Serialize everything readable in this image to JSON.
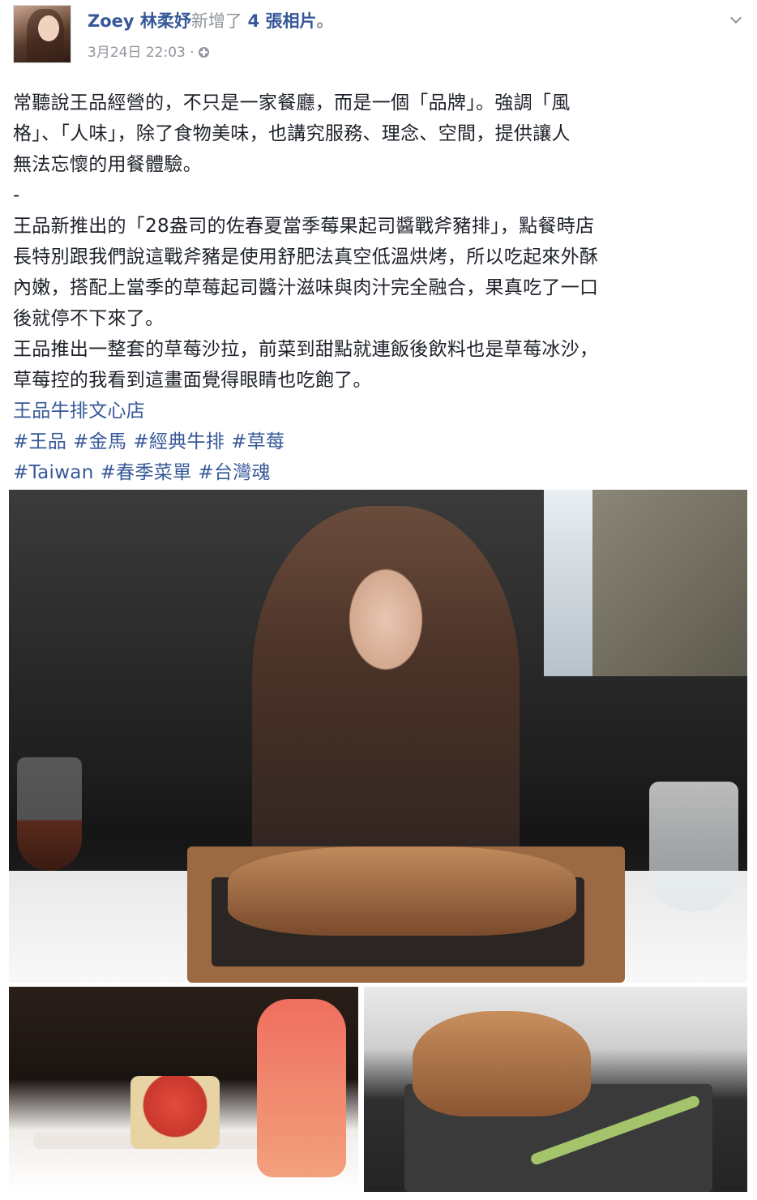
{
  "header": {
    "author_name": "Zoey 林柔妤",
    "added_text": "新增了",
    "photo_count_text": "4 張相片",
    "period": "。",
    "date_text": "3月24日 22:03",
    "meta_separator": " · ",
    "privacy_icon": "globe-icon",
    "menu_icon": "chevron-down-icon"
  },
  "post": {
    "paragraph1": [
      "常聽說王品經營的，不只是一家餐廳，而是一個「品牌」。強調「風",
      "格」、「人味」，除了食物美味，也講究服務、理念、空間，提供讓人",
      "無法忘懷的用餐體驗。"
    ],
    "separator": "-",
    "paragraph2": [
      "王品新推出的「28盎司的佐春夏當季莓果起司醬戰斧豬排」，點餐時店",
      "長特別跟我們說這戰斧豬是使用舒肥法真空低溫烘烤，所以吃起來外酥",
      "內嫩，搭配上當季的草莓起司醬汁滋味與肉汁完全融合，果真吃了一口",
      "後就停不下來了。",
      "王品推出一整套的草莓沙拉，前菜到甜點就連飯後飲料也是草莓冰沙，",
      "草莓控的我看到這畫面覺得眼睛也吃飽了。"
    ],
    "location_link": "王品牛排文心店",
    "hashtags_row1": [
      "#王品",
      "#金馬",
      "#經典牛排",
      "#草莓"
    ],
    "hashtags_row2": [
      "#Taiwan",
      "#春季菜單",
      "#台灣魂"
    ]
  },
  "photos": [
    "photo-main",
    "photo-left",
    "photo-right"
  ]
}
